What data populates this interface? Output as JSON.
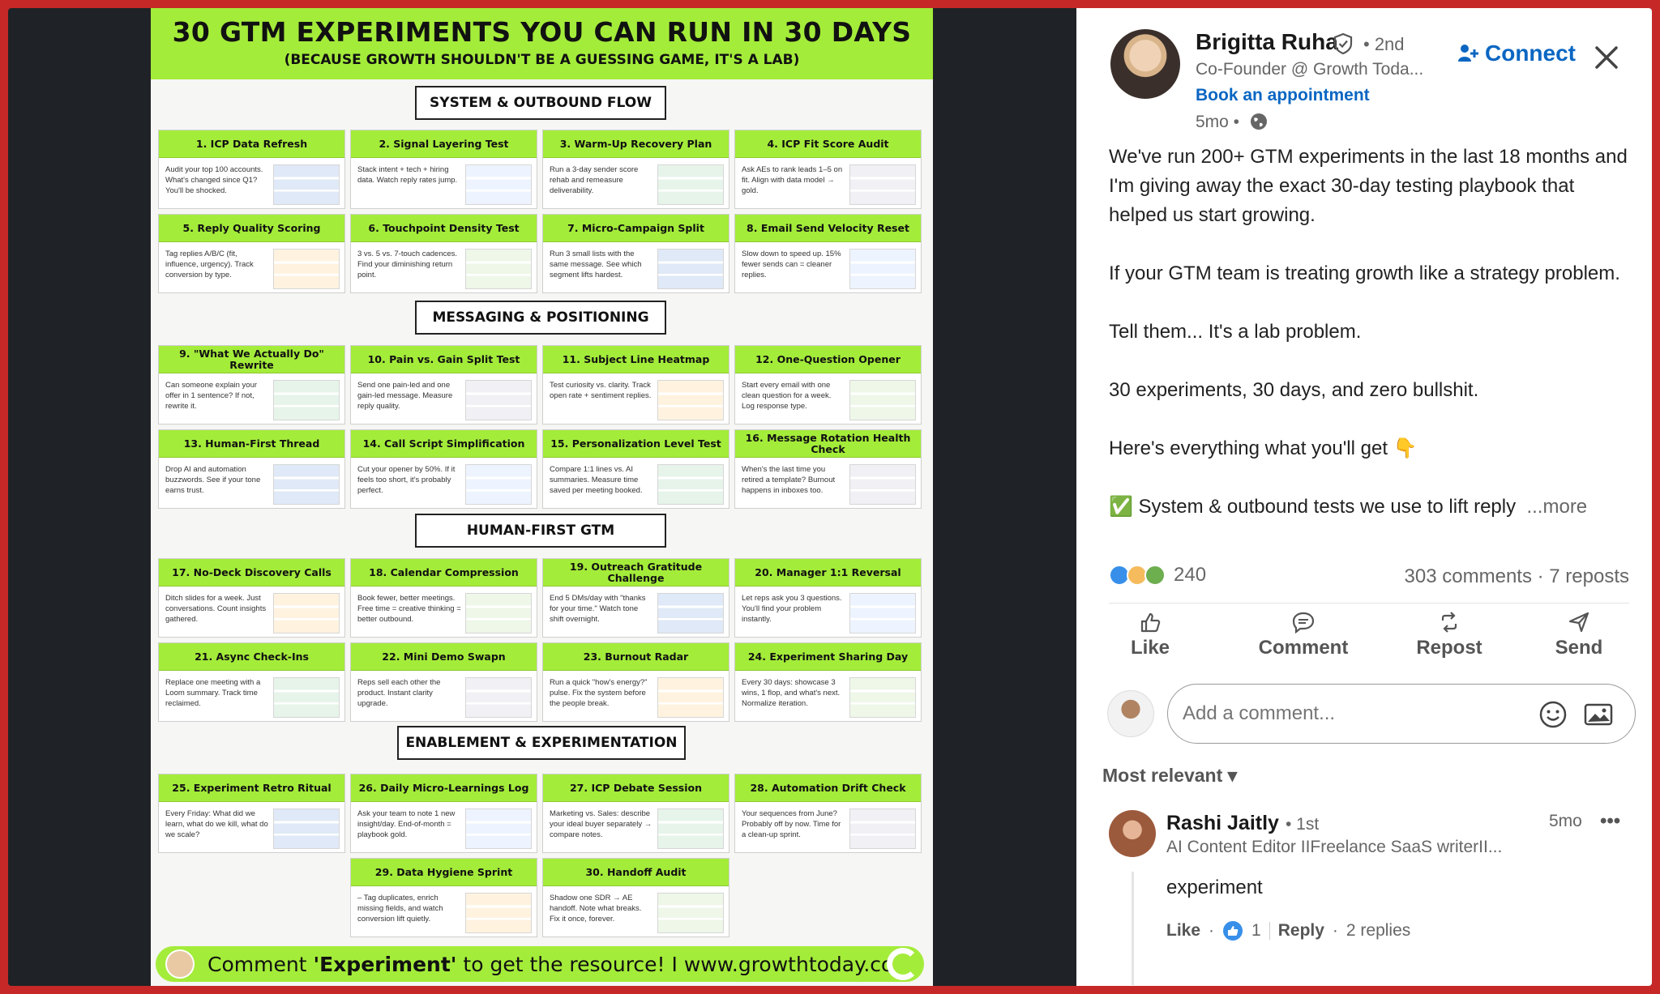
{
  "poster": {
    "title": "30 GTM EXPERIMENTS YOU CAN RUN IN 30 DAYS",
    "subtitle": "(BECAUSE GROWTH SHOULDN'T BE A GUESSING GAME, IT'S A LAB)",
    "sections": [
      "SYSTEM & OUTBOUND FLOW",
      "MESSAGING & POSITIONING",
      "HUMAN-FIRST GTM",
      "ENABLEMENT & EXPERIMENTATION"
    ],
    "cards": [
      {
        "title": "1. ICP Data Refresh",
        "body": "Audit your top 100 accounts. What's changed since Q1? You'll be shocked."
      },
      {
        "title": "2. Signal Layering Test",
        "body": "Stack intent + tech + hiring data. Watch reply rates jump."
      },
      {
        "title": "3. Warm-Up Recovery Plan",
        "body": "Run a 3-day sender score rehab and remeasure deliverability."
      },
      {
        "title": "4. ICP Fit Score Audit",
        "body": "Ask AEs to rank leads 1–5 on fit. Align with data model → gold."
      },
      {
        "title": "5. Reply Quality Scoring",
        "body": "Tag replies A/B/C (fit, influence, urgency). Track conversion by type."
      },
      {
        "title": "6. Touchpoint Density Test",
        "body": "3 vs. 5 vs. 7-touch cadences. Find your diminishing return point."
      },
      {
        "title": "7. Micro-Campaign Split",
        "body": "Run 3 small lists with the same message. See which segment lifts hardest."
      },
      {
        "title": "8. Email Send Velocity Reset",
        "body": "Slow down to speed up. 15% fewer sends can = cleaner replies."
      },
      {
        "title": "9. \"What We Actually Do\" Rewrite",
        "body": "Can someone explain your offer in 1 sentence? If not, rewrite it."
      },
      {
        "title": "10. Pain vs. Gain Split Test",
        "body": "Send one pain-led and one gain-led message. Measure reply quality."
      },
      {
        "title": "11. Subject Line Heatmap",
        "body": "Test curiosity vs. clarity. Track open rate + sentiment replies."
      },
      {
        "title": "12. One-Question Opener",
        "body": "Start every email with one clean question for a week. Log response type."
      },
      {
        "title": "13. Human-First Thread",
        "body": "Drop AI and automation buzzwords. See if your tone earns trust."
      },
      {
        "title": "14. Call Script Simplification",
        "body": "Cut your opener by 50%. If it feels too short, it's probably perfect."
      },
      {
        "title": "15. Personalization Level Test",
        "body": "Compare 1:1 lines vs. AI summaries. Measure time saved per meeting booked."
      },
      {
        "title": "16. Message Rotation Health Check",
        "body": "When's the last time you retired a template? Burnout happens in inboxes too."
      },
      {
        "title": "17. No-Deck Discovery Calls",
        "body": "Ditch slides for a week. Just conversations. Count insights gathered."
      },
      {
        "title": "18. Calendar Compression",
        "body": "Book fewer, better meetings. Free time = creative thinking = better outbound."
      },
      {
        "title": "19. Outreach Gratitude Challenge",
        "body": "End 5 DMs/day with \"thanks for your time.\" Watch tone shift overnight."
      },
      {
        "title": "20. Manager 1:1 Reversal",
        "body": "Let reps ask you 3 questions. You'll find your problem instantly."
      },
      {
        "title": "21. Async Check-Ins",
        "body": "Replace one meeting with a Loom summary. Track time reclaimed."
      },
      {
        "title": "22. Mini Demo Swapn",
        "body": "Reps sell each other the product. Instant clarity upgrade."
      },
      {
        "title": "23. Burnout Radar",
        "body": "Run a quick \"how's energy?\" pulse. Fix the system before the people break."
      },
      {
        "title": "24. Experiment Sharing Day",
        "body": "Every 30 days: showcase 3 wins, 1 flop, and what's next. Normalize iteration."
      },
      {
        "title": "25. Experiment Retro Ritual",
        "body": "Every Friday: What did we learn, what do we kill, what do we scale?"
      },
      {
        "title": "26. Daily Micro-Learnings Log",
        "body": "Ask your team to note 1 new insight/day. End-of-month = playbook gold."
      },
      {
        "title": "27. ICP Debate Session",
        "body": "Marketing vs. Sales: describe your ideal buyer separately → compare notes."
      },
      {
        "title": "28. Automation Drift Check",
        "body": "Your sequences from June? Probably off by now. Time for a clean-up sprint."
      },
      {
        "title": "29. Data Hygiene Sprint",
        "body": "– Tag duplicates, enrich missing fields, and watch conversion lift quietly."
      },
      {
        "title": "30. Handoff Audit",
        "body": "Shadow one SDR → AE handoff. Note what breaks. Fix it once, forever."
      }
    ],
    "footer": {
      "prefix": "Comment ",
      "keyword": "'Experiment'",
      "suffix": " to get the resource! I www.growthtoday.co"
    }
  },
  "post": {
    "author": {
      "name": "Brigitta Ruha",
      "degree": "• 2nd",
      "headline": "Co-Founder @ Growth Toda...",
      "book_link": "Book an appointment",
      "time": "5mo •"
    },
    "connect_label": "Connect",
    "paragraphs": [
      "We've run 200+ GTM experiments in the last 18 months and I'm giving away the exact 30-day testing playbook that helped us start growing.",
      "If your GTM team is treating growth like a strategy problem.",
      "Tell them... It's a lab problem.",
      "30 experiments, 30 days, and zero bullshit.",
      "Here's everything what you'll get 👇"
    ],
    "teaser": "✅ System & outbound tests we use to lift reply",
    "more_label": "...more",
    "reaction_count": "240",
    "stats": "303 comments · 7 reposts",
    "actions": [
      "Like",
      "Comment",
      "Repost",
      "Send"
    ],
    "comment_placeholder": "Add a comment...",
    "sort_label": "Most relevant ▾"
  },
  "comment": {
    "name": "Rashi Jaitly",
    "degree": "• 1st",
    "time": "5mo",
    "more": "•••",
    "headline": "AI Content Editor IIFreelance SaaS writerII...",
    "text": "experiment",
    "like_label": "Like",
    "like_count": "1",
    "reply_label": "Reply",
    "replies": "2 replies"
  },
  "colors": {
    "lime": "#a4ec3a",
    "linkedin_blue": "#0a66c2",
    "frame_red": "#c62828",
    "backdrop": "#1f2226"
  }
}
